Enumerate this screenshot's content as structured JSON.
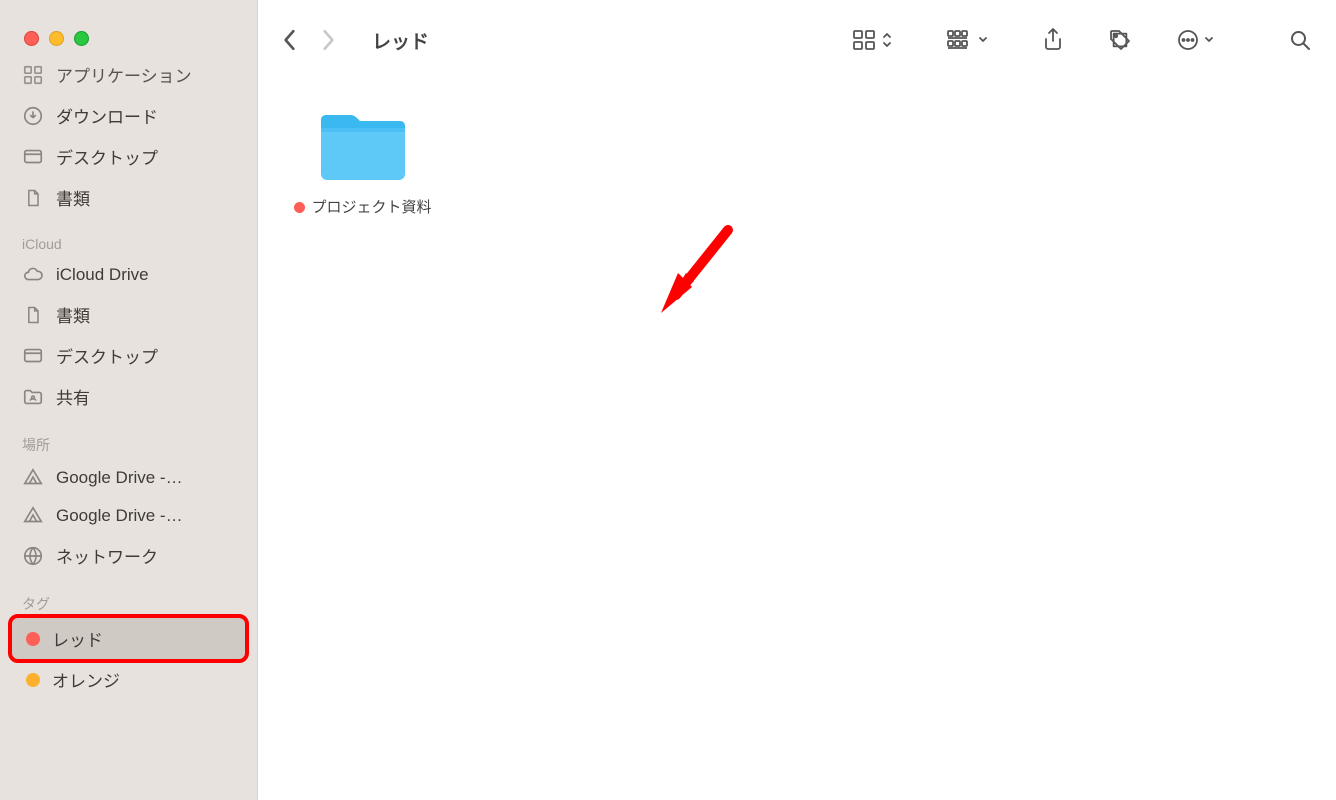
{
  "sidebar": {
    "favorites": [
      {
        "label": "アプリケーション",
        "icon": "apps"
      },
      {
        "label": "ダウンロード",
        "icon": "download"
      },
      {
        "label": "デスクトップ",
        "icon": "desktop"
      },
      {
        "label": "書類",
        "icon": "doc"
      }
    ],
    "icloud_header": "iCloud",
    "icloud": [
      {
        "label": "iCloud Drive",
        "icon": "cloud"
      },
      {
        "label": "書類",
        "icon": "doc"
      },
      {
        "label": "デスクトップ",
        "icon": "desktop"
      },
      {
        "label": "共有",
        "icon": "shared"
      }
    ],
    "locations_header": "場所",
    "locations": [
      {
        "label": "Google Drive -…",
        "icon": "gdrive"
      },
      {
        "label": "Google Drive -…",
        "icon": "gdrive"
      },
      {
        "label": "ネットワーク",
        "icon": "network"
      }
    ],
    "tags_header": "タグ",
    "tags": [
      {
        "label": "レッド",
        "color": "#fe5f57",
        "selected": true,
        "highlight": true
      },
      {
        "label": "オレンジ",
        "color": "#feb02c"
      }
    ]
  },
  "toolbar": {
    "title": "レッド"
  },
  "content": {
    "items": [
      {
        "name": "プロジェクト資料",
        "tag_color": "#fe5f57"
      }
    ]
  }
}
